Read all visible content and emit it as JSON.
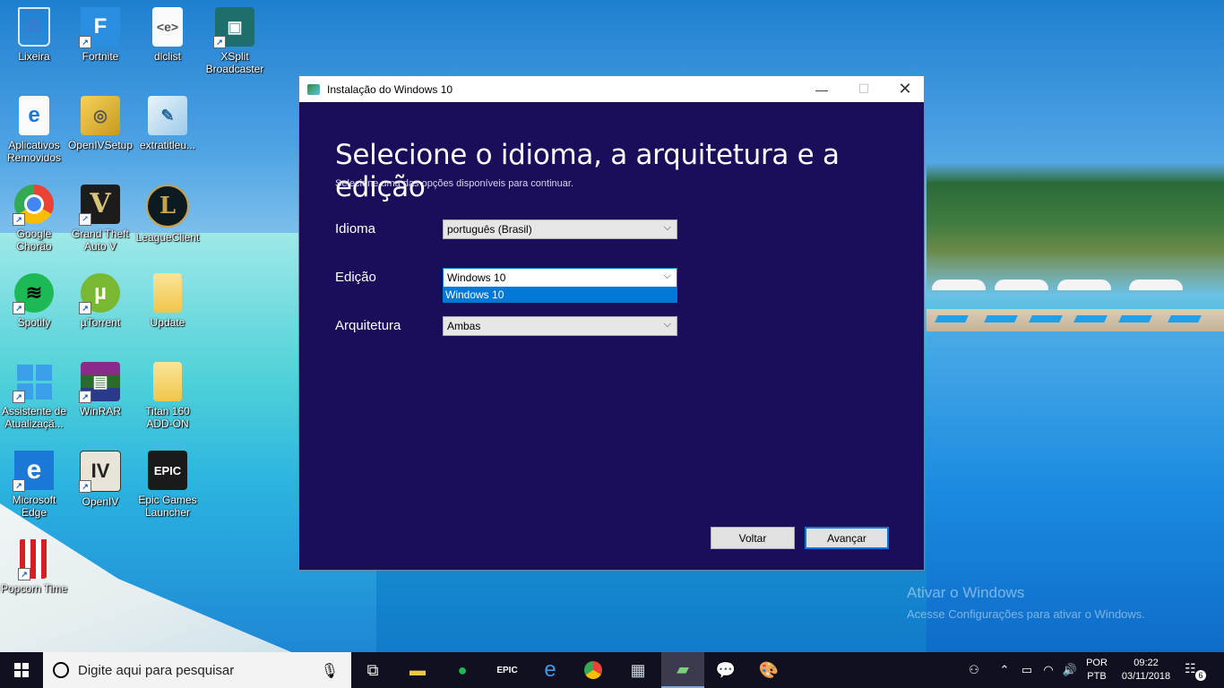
{
  "desktop": {
    "icons": [
      {
        "label": "Lixeira",
        "icon": "recycle-bin-icon"
      },
      {
        "label": "Fortnite",
        "icon": "fortnite-icon"
      },
      {
        "label": "dlclist",
        "icon": "document-icon"
      },
      {
        "label": "XSplit Broadcaster",
        "icon": "xsplit-icon"
      },
      {
        "label": "Aplicativos Removidos",
        "icon": "edge-document-icon"
      },
      {
        "label": "OpenIVSetup",
        "icon": "installer-icon"
      },
      {
        "label": "extratitleu...",
        "icon": "text-file-icon"
      },
      {
        "label": "Google Chorão",
        "icon": "chrome-icon"
      },
      {
        "label": "Grand Theft Auto V",
        "icon": "gta-v-icon"
      },
      {
        "label": "LeagueClient",
        "icon": "league-of-legends-icon"
      },
      {
        "label": "Spotify",
        "icon": "spotify-icon"
      },
      {
        "label": "µTorrent",
        "icon": "utorrent-icon"
      },
      {
        "label": "Update",
        "icon": "folder-icon"
      },
      {
        "label": "Assistente de Atualizaçã...",
        "icon": "windows-update-icon"
      },
      {
        "label": "WinRAR",
        "icon": "winrar-icon"
      },
      {
        "label": "Titan 160 ADD-ON",
        "icon": "folder-icon"
      },
      {
        "label": "Microsoft Edge",
        "icon": "edge-icon"
      },
      {
        "label": "OpenIV",
        "icon": "openiv-icon"
      },
      {
        "label": "Epic Games Launcher",
        "icon": "epic-games-icon"
      },
      {
        "label": "Popcorn Time",
        "icon": "popcorn-icon"
      }
    ],
    "watermark": {
      "title": "Ativar o Windows",
      "subtitle": "Acesse Configurações para ativar o Windows."
    }
  },
  "dialog": {
    "title": "Instalação do Windows 10",
    "heading": "Selecione o idioma, a arquitetura e a edição",
    "subheading": "Selecione uma das opções disponíveis para continuar.",
    "fields": {
      "language": {
        "label": "Idioma",
        "value": "português (Brasil)"
      },
      "edition": {
        "label": "Edição",
        "value": "Windows 10",
        "open_option": "Windows 10"
      },
      "architecture": {
        "label": "Arquitetura",
        "value": "Ambas"
      }
    },
    "buttons": {
      "back": "Voltar",
      "next": "Avançar"
    }
  },
  "taskbar": {
    "search_placeholder": "Digite aqui para pesquisar",
    "language_line1": "POR",
    "language_line2": "PTB",
    "time": "09:22",
    "date": "03/11/2018",
    "notification_count": "6"
  }
}
